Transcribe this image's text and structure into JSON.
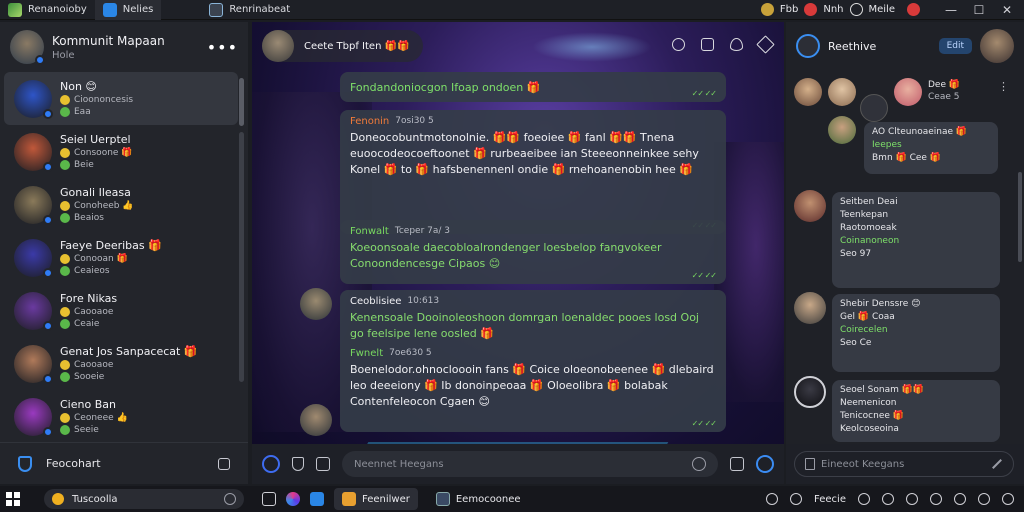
{
  "titlebar": {
    "app_title": "Renanoioby",
    "tab1": "Nelies",
    "tab2": "Renrinabeat",
    "right_item1": "Fbb",
    "right_item2": "Nnh",
    "right_item3": "Meile",
    "minimize": "—",
    "maximize": "☐",
    "close": "✕"
  },
  "sidebar": {
    "title": "Kommunit Mapaan",
    "subtitle": "Hole",
    "more": "•••",
    "conversations": [
      {
        "name": "Non 😊",
        "line1": "Cioononcesis",
        "line2": "Eaa",
        "color": "#2e55c8"
      },
      {
        "name": "Seiel Uerptel",
        "line1": "Consoone 🎁",
        "line2": "Beie",
        "color": "#c0583a"
      },
      {
        "name": "Gonali Ileasa",
        "line1": "Conoheeb 👍",
        "line2": "Beaios",
        "color": "#8a7a5a"
      },
      {
        "name": "Faeye Deeribas 🎁",
        "line1": "Conooan 🎁",
        "line2": "Ceaieos",
        "color": "#3b3aa8"
      },
      {
        "name": "Fore Nikas",
        "line1": "Caooaoe",
        "line2": "Ceaie",
        "color": "#6a3aa0"
      },
      {
        "name": "Genat Jos Sanpacecat 🎁",
        "line1": "Caooaoe",
        "line2": "Sooeie",
        "color": "#b07a5a"
      },
      {
        "name": "Cieno Ban",
        "line1": "Ceoneee 👍",
        "line2": "Seeie",
        "color": "#9a3ac0"
      }
    ],
    "footer_label": "Feocohart"
  },
  "chat": {
    "header_title": "Ceete Tbpf Iten 🎁🎁",
    "system_message": "Fondandoniocgon Ifoap ondoen 🎁",
    "message1_sender": "Fenonin",
    "message1_time": "7osi30 5",
    "message1_text": "Doneocobuntmotonolnie. 🎁🎁 foeoiee 🎁 fanl 🎁🎁 Tnena euoocodeocoeftoonet 🎁 rurbeaeibee ian Steeeonneinkee sehy Konel 🎁 to 🎁 hafsbenennenl ondie 🎁 rnehoanenobin hee 🎁",
    "message2_sender": "Fonwalt",
    "message2_time": "Tceper 7a/ 3",
    "message2_text": "Koeoonsoale daecobloalrondenger loesbelop fangvokeer Conoondencesge Cipaos 😊",
    "message3_sender": "Ceoblisiee",
    "message3_time": "10:613",
    "message3_text": "Kenensoale Dooinoleoshoon domrgan loenaldec pooes losd Ooj go feelsipe lene oosled 🎁",
    "message4_sender": "Fwnelt",
    "message4_time": "7oe630 5",
    "message4_text": "Boenelodor.ohnocloooin fans 🎁 Coice oloeonobeenee 🎁 dlebaird leo deeeiony 🎁 Ib donoinpeoaa 🎁 Oloeolibra 🎁 bolabak Contenfeleocon Cgaen 😊",
    "ticks": "✓✓ ✓✓",
    "input_placeholder": "Neennet Heegans"
  },
  "right_panel": {
    "name": "Reethive",
    "edit_label": "Edit",
    "r1_line1": "Dee 🎁",
    "r1_line2": "Ceae 5",
    "r2_title": "AO Clteunoaeinae 🎁",
    "r2_line1": "Ieepes",
    "r2_line2": "Bmn 🎁 Cee 🎁",
    "r3_title": "Seitben Deai",
    "r3_line1": "Teenkepan",
    "r3_line2": "Raotomoeak",
    "r3_line3": "Coinanoneon",
    "r3_line4": "Seo 97",
    "r4_title": "Shebir Denssre 😊",
    "r4_line1": "Gel 🎁 Coaa",
    "r4_line2": "Coirecelen",
    "r4_line3": "Seo Ce",
    "r5_title": "Seoel Sonam 🎁🎁",
    "r5_line1": "Neemenicon",
    "r5_line2": "Tenicocnee 🎁",
    "r5_line3": "Keolcoseoina",
    "input_placeholder": "Eineeot Keegans"
  },
  "taskbar": {
    "search_label": "Tuscoolla",
    "app1": "Feenilwer",
    "app2": "Eemocoonee",
    "tray_text": "Feecie"
  }
}
